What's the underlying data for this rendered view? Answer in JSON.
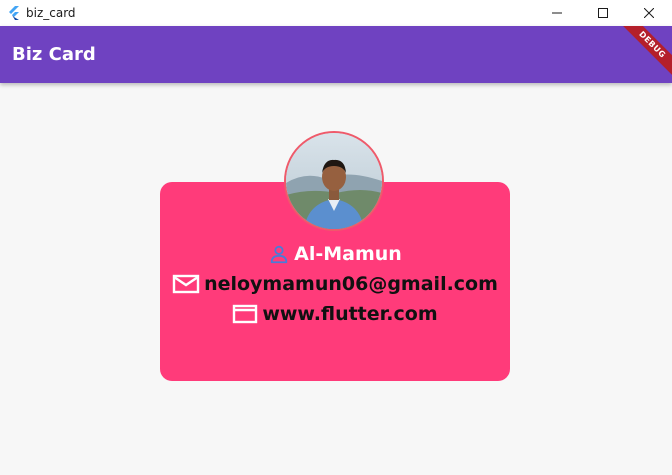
{
  "window": {
    "title": "biz_card",
    "icon": "flutter-logo-icon"
  },
  "appbar": {
    "title": "Biz Card",
    "debug_label": "DEBUG"
  },
  "card": {
    "name": "Al-Mamun",
    "email": "neloymamun06@gmail.com",
    "website": "www.flutter.com",
    "icons": {
      "name": "person-icon",
      "email": "mail-icon",
      "website": "web-icon"
    }
  },
  "colors": {
    "appbar": "#6f42c1",
    "card": "#ff3b7a",
    "background": "#f7f7f7",
    "person_icon": "#4a7bd8",
    "contact_icon": "#ffffff",
    "debug_banner": "#b41f2b"
  }
}
